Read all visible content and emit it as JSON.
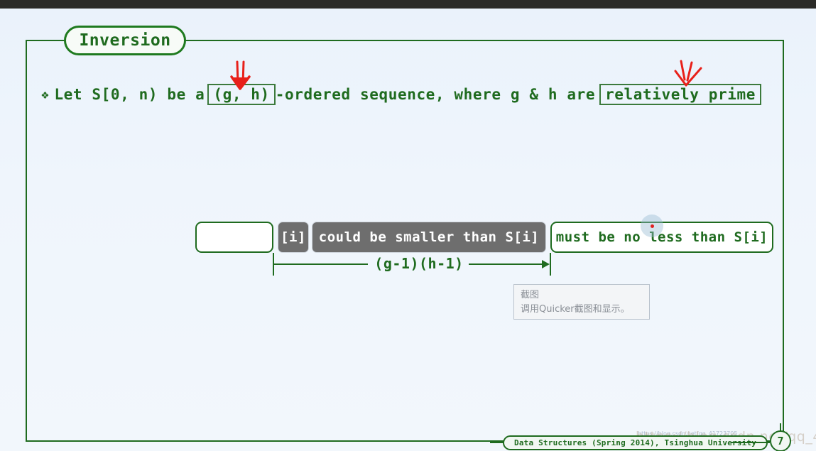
{
  "window": {
    "topbar_color": "#2b2b28",
    "background_color": "#eef4fb"
  },
  "slide": {
    "title": "Inversion",
    "accent_color": "#1f6b1f",
    "bullet": {
      "mark": "❖",
      "text_before": "Let S[0, n) be a",
      "boxed_gh": "(g, h)",
      "text_middle": "-ordered sequence, where g & h are",
      "boxed_relatively_prime": "relatively prime"
    },
    "annotations": [
      {
        "name": "red-arrow-over-gh",
        "color": "#e8201a",
        "style": "double-stroke-down-arrow"
      },
      {
        "name": "red-arrow-over-relatively-prime",
        "color": "#e8201a",
        "style": "hand-drawn-down-arrow"
      }
    ],
    "diagram": {
      "segments": [
        {
          "id": "empty",
          "label": "",
          "variant": "white"
        },
        {
          "id": "index",
          "label": "[i]",
          "variant": "dark"
        },
        {
          "id": "smaller",
          "label": "could be smaller than S[i]",
          "variant": "dark"
        },
        {
          "id": "noless",
          "label": "must be no less than S[i]",
          "variant": "white"
        }
      ],
      "measure_label": "(g-1)(h-1)"
    },
    "footer": {
      "text": "Data Structures (Spring 2014), Tsinghua University",
      "page_number": "7"
    },
    "watermark": "https://blog.csdn.net/qq_41723705",
    "watermark_small": "https://blog.csdn.net/qq_41723705"
  },
  "tooltip": {
    "title": "截图",
    "description": "调用Quicker截图和显示。"
  }
}
